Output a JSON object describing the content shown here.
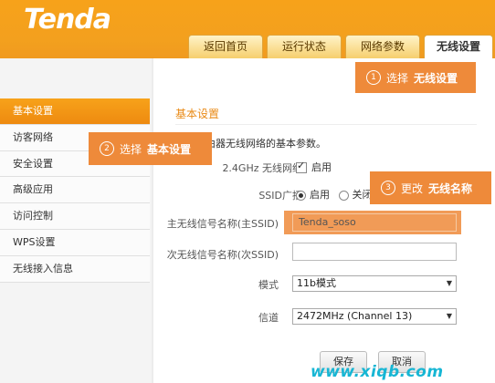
{
  "brand": {
    "logo": "Tenda"
  },
  "tabs": [
    {
      "label": "返回首页"
    },
    {
      "label": "运行状态"
    },
    {
      "label": "网络参数"
    },
    {
      "label": "无线设置"
    }
  ],
  "sidebar": {
    "items": [
      {
        "label": "基本设置"
      },
      {
        "label": "访客网络"
      },
      {
        "label": "安全设置"
      },
      {
        "label": "高级应用"
      },
      {
        "label": "访问控制"
      },
      {
        "label": "WPS设置"
      },
      {
        "label": "无线接入信息"
      }
    ]
  },
  "main": {
    "title": "基本设置",
    "description": "配置路由器无线网络的基本参数。",
    "rows": {
      "wireless_24": {
        "label": "2.4GHz 无线网络",
        "value": "启用"
      },
      "ssid_broadcast": {
        "label": "SSID广播",
        "option_on": "启用",
        "option_off": "关闭"
      },
      "primary_ssid": {
        "label": "主无线信号名称(主SSID)",
        "value": "Tenda_soso"
      },
      "secondary_ssid": {
        "label": "次无线信号名称(次SSID)",
        "value": ""
      },
      "mode": {
        "label": "模式",
        "value": "11b模式"
      },
      "channel": {
        "label": "信道",
        "value": "2472MHz (Channel 13)"
      }
    },
    "buttons": {
      "save": "保存",
      "cancel": "取消"
    }
  },
  "callouts": [
    {
      "num": "1",
      "text": "选择",
      "bold": "无线设置"
    },
    {
      "num": "2",
      "text": "选择",
      "bold": "基本设置"
    },
    {
      "num": "3",
      "text": "更改",
      "bold": "无线名称"
    }
  ],
  "watermark": "www.xiqb.com",
  "colors": {
    "header_orange": "#f7a21a",
    "callout_orange": "#ee8a3a",
    "title_orange": "#e98a15"
  }
}
